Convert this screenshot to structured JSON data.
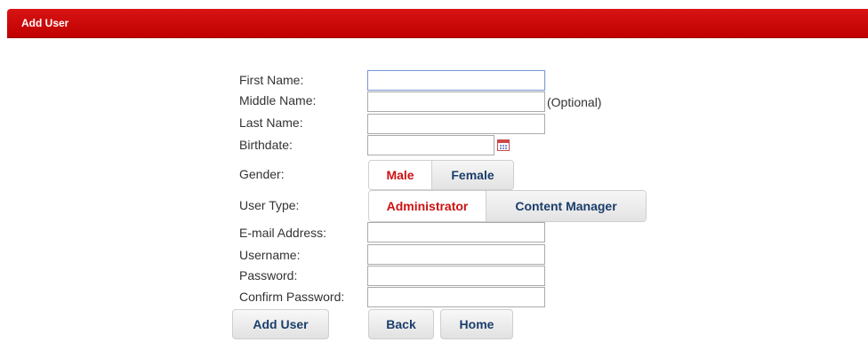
{
  "header": {
    "title": "Add User"
  },
  "form": {
    "labels": {
      "first_name": "First Name:",
      "middle_name": "Middle Name:",
      "last_name": "Last Name:",
      "birthdate": "Birthdate:",
      "gender": "Gender:",
      "user_type": "User Type:",
      "email": "E-mail Address:",
      "username": "Username:",
      "password": "Password:",
      "confirm_password": "Confirm Password:"
    },
    "values": {
      "first_name": "",
      "middle_name": "",
      "last_name": "",
      "birthdate": "",
      "email": "",
      "username": "",
      "password": "",
      "confirm_password": ""
    },
    "optional_note": "(Optional)",
    "birthdate_icon": "calendar-icon",
    "gender_options": [
      "Male",
      "Female"
    ],
    "gender_selected": "Male",
    "user_type_options": [
      "Administrator",
      "Content Manager"
    ],
    "user_type_selected": "Administrator"
  },
  "buttons": {
    "add_user": "Add User",
    "back": "Back",
    "home": "Home"
  },
  "colors": {
    "header": "#cc0000",
    "selected_text": "#cc1111",
    "button_text": "#1b3e6b"
  }
}
